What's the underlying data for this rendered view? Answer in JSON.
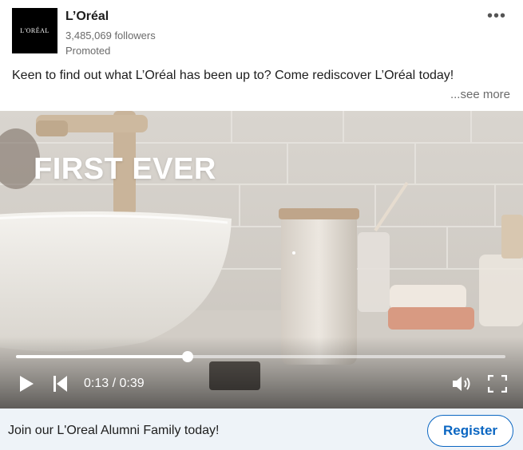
{
  "post": {
    "company_name": "L’Oréal",
    "logo_text": "L'ORÉAL",
    "followers": "3,485,069 followers",
    "promoted": "Promoted",
    "more_icon": "•••",
    "caption": "Keen to find out what L’Oréal has been up to? Come rediscover L’Oréal today!",
    "see_more": "...see more"
  },
  "video": {
    "overlay_text": "FIRST EVER",
    "current_time": "0:13",
    "duration": "0:39",
    "time_display": "0:13 / 0:39",
    "progress_fraction": 0.35,
    "icons": [
      "play-icon",
      "skip-back-icon",
      "volume-icon",
      "fullscreen-icon"
    ]
  },
  "cta": {
    "text": "Join our L'Oreal Alumni Family today!",
    "button_label": "Register"
  },
  "colors": {
    "brand_blue": "#0a66c2",
    "cta_background": "#eef3f8",
    "logo_background": "#000000"
  }
}
